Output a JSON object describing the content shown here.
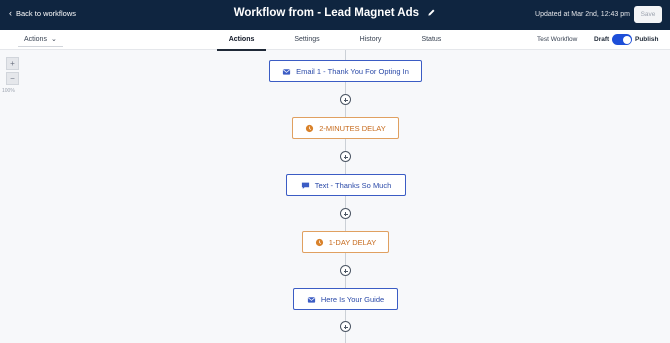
{
  "header": {
    "back_label": "Back to workflows",
    "title": "Workflow from - Lead Magnet Ads",
    "updated": "Updated at Mar 2nd, 12:43 pm",
    "save_label": "Save"
  },
  "subbar": {
    "actions_label": "Actions",
    "tabs": [
      {
        "label": "Actions"
      },
      {
        "label": "Settings"
      },
      {
        "label": "History"
      },
      {
        "label": "Status"
      }
    ],
    "test_label": "Test Workflow",
    "draft_label": "Draft",
    "publish_label": "Publish"
  },
  "zoom": {
    "plus": "+",
    "minus": "−",
    "level": "100%"
  },
  "flow": {
    "steps": [
      {
        "label": "Email 1 - Thank You For Opting In",
        "icon": "email-icon"
      },
      {
        "label": "2-MINUTES DELAY",
        "icon": "clock-icon"
      },
      {
        "label": "Text - Thanks So Much",
        "icon": "chat-icon"
      },
      {
        "label": "1-DAY DELAY",
        "icon": "clock-icon"
      },
      {
        "label": "Here Is Your Guide",
        "icon": "email-icon"
      }
    ]
  },
  "colors": {
    "topbar": "#0f2540",
    "accent": "#1d4ed8",
    "email_border": "#3b5cc4",
    "delay_border": "#e0a060",
    "delay_text": "#c66a1c"
  }
}
